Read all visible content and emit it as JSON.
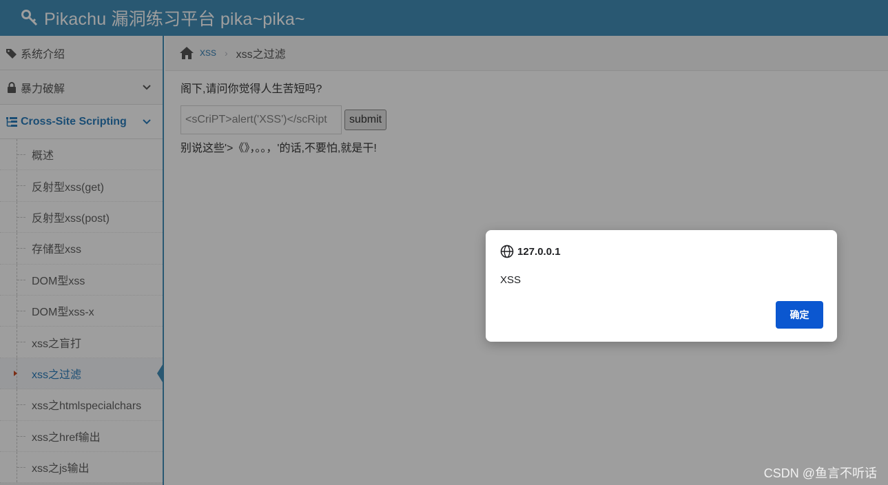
{
  "header": {
    "title": "Pikachu 漏洞练习平台 pika~pika~",
    "bg_color": "#438eb9"
  },
  "sidebar": {
    "top_items": [
      {
        "label": "系统介绍",
        "icon": "tags-icon"
      },
      {
        "label": "暴力破解",
        "icon": "lock-icon"
      },
      {
        "label": "Cross-Site Scripting",
        "icon": "tree-icon"
      }
    ],
    "sub_items": [
      "概述",
      "反射型xss(get)",
      "反射型xss(post)",
      "存储型xss",
      "DOM型xss",
      "DOM型xss-x",
      "xss之盲打",
      "xss之过滤",
      "xss之htmlspecialchars",
      "xss之href输出",
      "xss之js输出"
    ],
    "current_sub_item": "xss之过滤"
  },
  "breadcrumb": {
    "link": "xss",
    "current": "xss之过滤"
  },
  "main": {
    "question": "阁下,请问你觉得人生苦短吗?",
    "input_value": "<sCriPT>alert('XSS')</scRipt",
    "submit_label": "submit",
    "result_text": "别说这些'>《》，。。，'的话,不要怕,就是干!"
  },
  "dialog": {
    "origin": "127.0.0.1",
    "message": "XSS",
    "ok_label": "确定",
    "ok_color": "#0b57d0"
  },
  "watermark": "CSDN @鱼言不听话"
}
